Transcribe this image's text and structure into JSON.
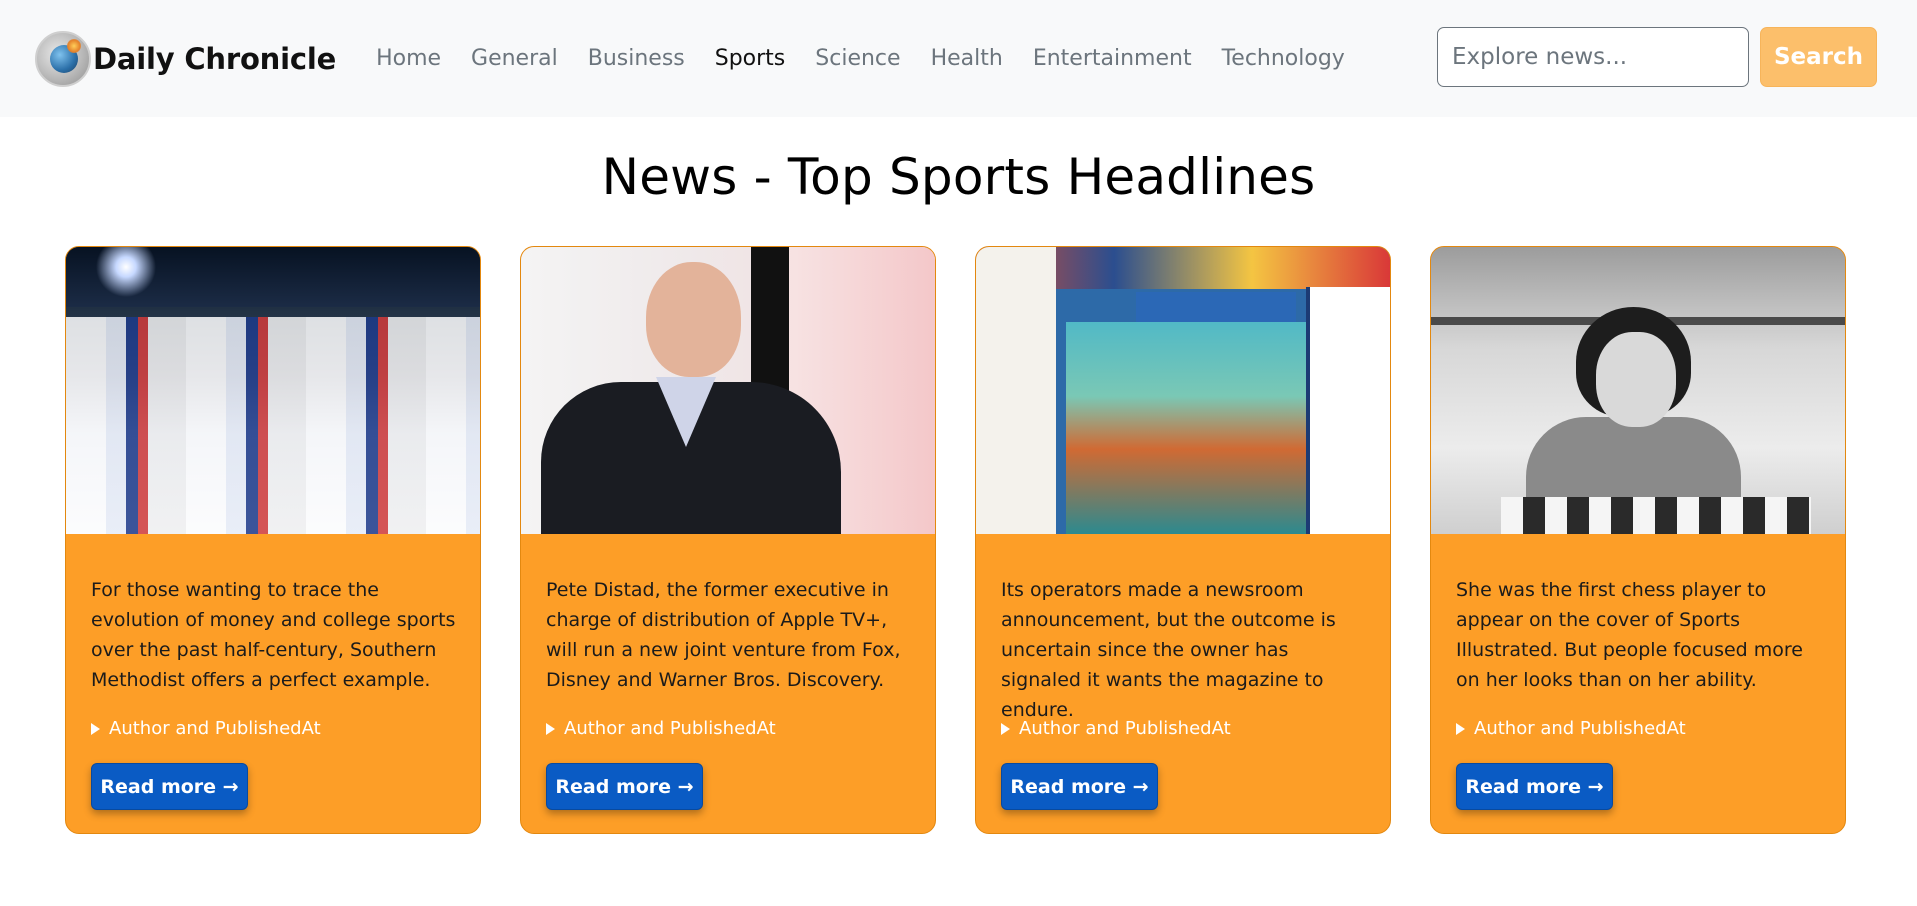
{
  "brand": {
    "name": "Daily Chronicle"
  },
  "nav": {
    "links": [
      "Home",
      "General",
      "Business",
      "Sports",
      "Science",
      "Health",
      "Entertainment",
      "Technology"
    ],
    "active": "Sports"
  },
  "search": {
    "placeholder": "Explore news...",
    "button_label": "Search"
  },
  "page_title": "News - Top Sports Headlines",
  "colors": {
    "card_bg": "#fd9e27",
    "button_blue": "#0a5bc4",
    "search_button": "#fcbf6b"
  },
  "cards": [
    {
      "image": "stadium-celebration-photo",
      "description": "For those wanting to trace the evolution of money and college sports over the past half-century, Southern Methodist offers a perfect example.",
      "meta": "Author and PublishedAt",
      "button": "Read more →"
    },
    {
      "image": "executive-portrait-photo",
      "description": "Pete Distad, the former executive in charge of distribution of Apple TV+, will run a new joint venture from Fox, Disney and Warner Bros. Discovery.",
      "meta": "Author and PublishedAt",
      "button": "Read more →"
    },
    {
      "image": "magazines-stack-photo",
      "description": "Its operators made a newsroom announcement, but the outcome is uncertain since the owner has signaled it wants the magazine to endure.",
      "meta": "Author and PublishedAt",
      "button": "Read more →"
    },
    {
      "image": "chess-player-photo",
      "description": "She was the first chess player to appear on the cover of Sports Illustrated. But people focused more on her looks than on her ability.",
      "meta": "Author and PublishedAt",
      "button": "Read more →"
    }
  ]
}
